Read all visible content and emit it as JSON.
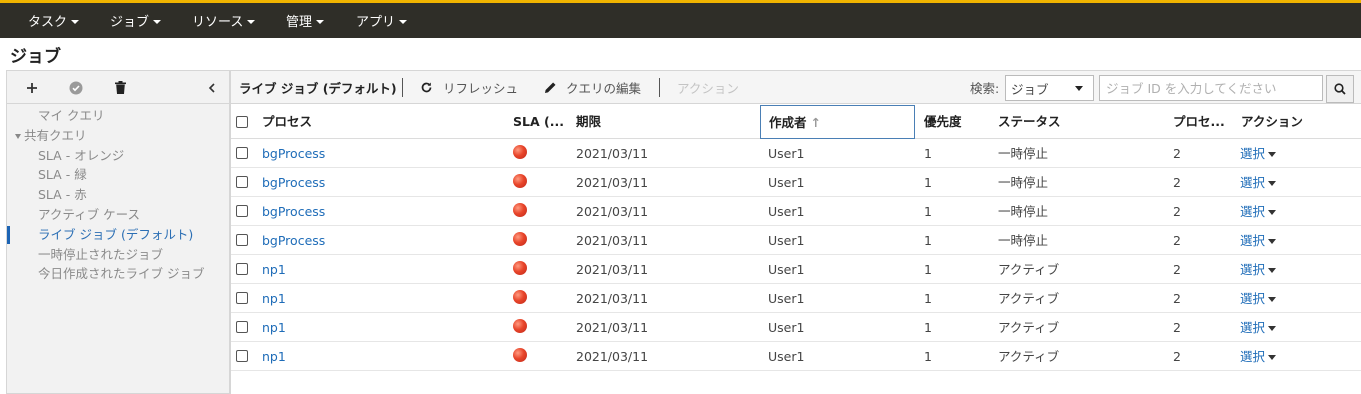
{
  "nav": {
    "items": [
      {
        "label": "タスク"
      },
      {
        "label": "ジョブ"
      },
      {
        "label": "リソース"
      },
      {
        "label": "管理"
      },
      {
        "label": "アプリ"
      }
    ]
  },
  "page": {
    "title": "ジョブ"
  },
  "colors": {
    "accent": "#f0b400",
    "nav_bg": "#2f2e28",
    "link": "#1e6cb8",
    "sla_red": "#e8452a"
  },
  "sidebar": {
    "toolbar_icons": [
      "plus-icon",
      "check-circle-icon",
      "trash-icon",
      "chevron-left-icon"
    ],
    "items": [
      {
        "label": "マイ クエリ",
        "type": "item"
      },
      {
        "label": "共有クエリ",
        "type": "group"
      },
      {
        "label": "SLA - オレンジ",
        "type": "item"
      },
      {
        "label": "SLA - 緑",
        "type": "item"
      },
      {
        "label": "SLA - 赤",
        "type": "item"
      },
      {
        "label": "アクティブ ケース",
        "type": "item"
      },
      {
        "label": "ライブ ジョブ (デフォルト)",
        "type": "item",
        "active": true
      },
      {
        "label": "一時停止されたジョブ",
        "type": "item"
      },
      {
        "label": "今日作成されたライブ ジョブ",
        "type": "item"
      }
    ]
  },
  "toolbar": {
    "query_title": "ライブ ジョブ (デフォルト)",
    "refresh_label": "リフレッシュ",
    "edit_query_label": "クエリの編集",
    "actions_label": "アクション",
    "search_label": "検索:",
    "search_scope": "ジョブ",
    "search_placeholder": "ジョブ ID を入力してください"
  },
  "table": {
    "headers": {
      "process": "プロセス",
      "sla": "SLA (...",
      "due": "期限",
      "creator": "作成者",
      "priority": "優先度",
      "status": "ステータス",
      "process_instances": "プロセ...",
      "actions": "アクション"
    },
    "sort": {
      "column": "creator",
      "direction": "ascending"
    },
    "rows": [
      {
        "process": "bgProcess",
        "sla": "red",
        "due": "2021/03/11",
        "creator": "User1",
        "priority": "1",
        "status": "一時停止",
        "count": "2",
        "action": "選択"
      },
      {
        "process": "bgProcess",
        "sla": "red",
        "due": "2021/03/11",
        "creator": "User1",
        "priority": "1",
        "status": "一時停止",
        "count": "2",
        "action": "選択"
      },
      {
        "process": "bgProcess",
        "sla": "red",
        "due": "2021/03/11",
        "creator": "User1",
        "priority": "1",
        "status": "一時停止",
        "count": "2",
        "action": "選択"
      },
      {
        "process": "bgProcess",
        "sla": "red",
        "due": "2021/03/11",
        "creator": "User1",
        "priority": "1",
        "status": "一時停止",
        "count": "2",
        "action": "選択"
      },
      {
        "process": "np1",
        "sla": "red",
        "due": "2021/03/11",
        "creator": "User1",
        "priority": "1",
        "status": "アクティブ",
        "count": "2",
        "action": "選択"
      },
      {
        "process": "np1",
        "sla": "red",
        "due": "2021/03/11",
        "creator": "User1",
        "priority": "1",
        "status": "アクティブ",
        "count": "2",
        "action": "選択"
      },
      {
        "process": "np1",
        "sla": "red",
        "due": "2021/03/11",
        "creator": "User1",
        "priority": "1",
        "status": "アクティブ",
        "count": "2",
        "action": "選択"
      },
      {
        "process": "np1",
        "sla": "red",
        "due": "2021/03/11",
        "creator": "User1",
        "priority": "1",
        "status": "アクティブ",
        "count": "2",
        "action": "選択"
      }
    ]
  }
}
